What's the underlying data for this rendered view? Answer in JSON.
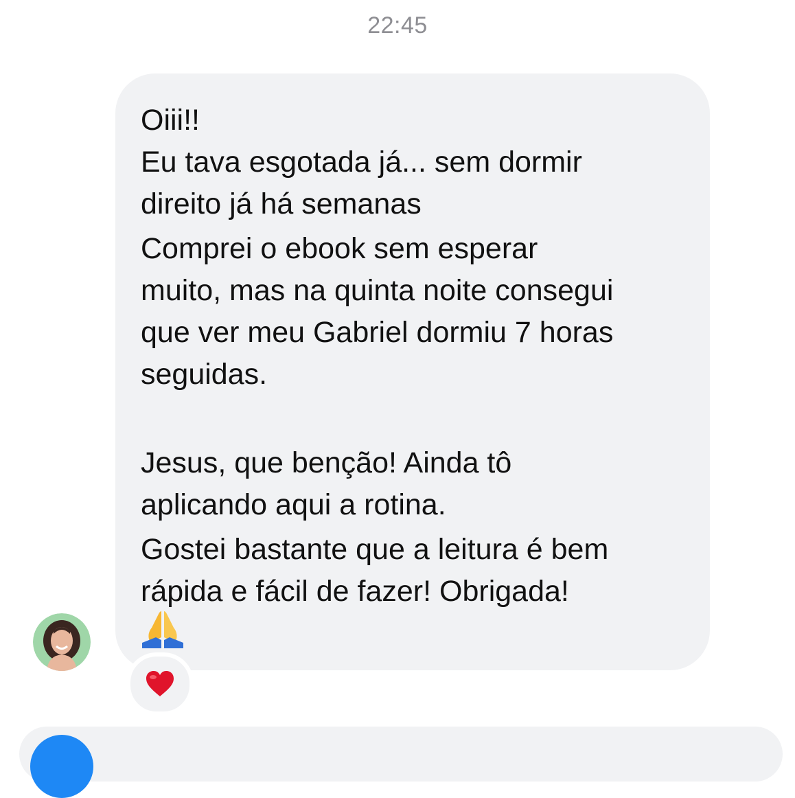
{
  "chat": {
    "timestamp": "22:45",
    "message": {
      "lines": [
        "Oiii!!",
        "Eu tava esgotada já... sem dormir",
        "direito já há semanas",
        "Comprei o ebook sem esperar",
        "muito, mas na quinta noite consegui",
        "que ver meu Gabriel dormiu 7 horas",
        "seguidas.",
        "",
        "Jesus, que benção! Ainda tô",
        "aplicando aqui a rotina.",
        "Gostei bastante que a leitura é bem",
        "rápida e fácil de fazer! Obrigada!"
      ],
      "trailing_emoji": "praying-hands-emoji"
    },
    "reaction": "heart-emoji"
  },
  "colors": {
    "bubble": "#f1f2f4",
    "timestamp": "#8e8e93",
    "accent": "#1e88f5",
    "heart": "#e0142b"
  }
}
